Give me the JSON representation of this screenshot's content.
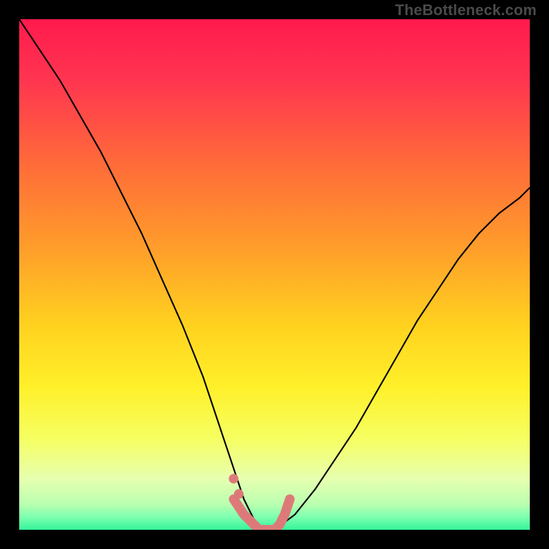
{
  "watermark": "TheBottleneck.com",
  "colors": {
    "background": "#000000",
    "curve": "#000000",
    "marker_fill": "#dd7a79",
    "gradient_stops": [
      {
        "offset": 0.0,
        "color": "#ff1a4d"
      },
      {
        "offset": 0.12,
        "color": "#ff3550"
      },
      {
        "offset": 0.28,
        "color": "#ff6a3a"
      },
      {
        "offset": 0.45,
        "color": "#ff9e2a"
      },
      {
        "offset": 0.6,
        "color": "#ffd21f"
      },
      {
        "offset": 0.72,
        "color": "#fff02a"
      },
      {
        "offset": 0.82,
        "color": "#f6ff60"
      },
      {
        "offset": 0.9,
        "color": "#e7ffb0"
      },
      {
        "offset": 0.95,
        "color": "#baffb0"
      },
      {
        "offset": 0.975,
        "color": "#7dffb0"
      },
      {
        "offset": 1.0,
        "color": "#34f59b"
      }
    ]
  },
  "chart_data": {
    "type": "line",
    "title": "",
    "xlabel": "",
    "ylabel": "",
    "xlim": [
      0,
      100
    ],
    "ylim": [
      0,
      100
    ],
    "series": [
      {
        "name": "bottleneck-curve",
        "x": [
          0,
          4,
          8,
          12,
          16,
          20,
          24,
          28,
          32,
          36,
          38,
          40,
          42,
          44,
          46,
          48,
          50,
          54,
          58,
          62,
          66,
          70,
          74,
          78,
          82,
          86,
          90,
          94,
          98,
          100
        ],
        "values": [
          100,
          94,
          88,
          81,
          74,
          66,
          58,
          49,
          40,
          30,
          24,
          18,
          12,
          6,
          2,
          0,
          0,
          3,
          8,
          14,
          20,
          27,
          34,
          41,
          47,
          53,
          58,
          62,
          65,
          67
        ]
      }
    ],
    "markers": {
      "name": "optimal-range",
      "x": [
        42,
        44,
        45,
        46,
        47,
        48,
        49,
        50,
        51,
        52,
        53
      ],
      "values": [
        6,
        3,
        2,
        1,
        0,
        0,
        0,
        0,
        1,
        3,
        6
      ]
    }
  }
}
